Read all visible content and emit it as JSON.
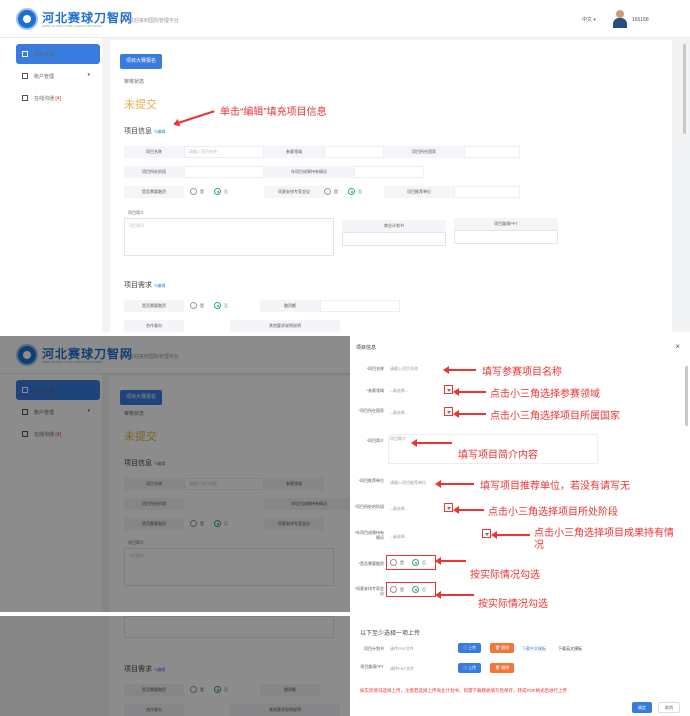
{
  "app": {
    "logo_text": "河北赛球刀智网",
    "logo_sub": "HEBEI GLOBAL INTELLIGENCE NETWORK",
    "welcome": "hi，欢迎来到国际管理平台",
    "language": "中文 ▾",
    "username": "165168"
  },
  "sidebar": {
    "items": [
      {
        "label": "项目大赛",
        "active": true
      },
      {
        "label": "账户管理",
        "chevron": "▾"
      },
      {
        "label": "在线沟通",
        "badge": "[4]"
      }
    ]
  },
  "main": {
    "tab": "项目大赛报名",
    "review_status_label": "审核状态",
    "status": "未提交",
    "project_info_title": "项目信息",
    "project_req_title": "项目需求",
    "edit": "✎编辑",
    "fields": {
      "name_label": "项目名称",
      "name_placeholder": "请输入项目名称",
      "field_label": "参赛领域",
      "country_label": "项目所在国家",
      "stage_label": "项目所处阶段",
      "result_label": "年项目成果持有情况",
      "invest_label": "是否需要融资",
      "yes": "是",
      "no": "否",
      "agree_label": "同意安排专家会议",
      "recommend_label": "项目推荐单位",
      "intro_label": "项目简介",
      "intro_placeholder": "项目简介",
      "bp_label": "商业计划书",
      "ppt_label": "项目路演PPT",
      "partner_label": "合作意向",
      "partner_desc_label": "其他要求说明说明",
      "finance_label": "是否需要融资",
      "amount_label": "融资额"
    }
  },
  "modal": {
    "title": "项目信息",
    "close": "×",
    "rows": [
      {
        "label": "项目名称",
        "value": "请输入项目名称"
      },
      {
        "label": "参赛领域",
        "value": "--请选择--"
      },
      {
        "label": "项目所在国家",
        "value": "--请选择--"
      },
      {
        "label": "项目简介",
        "value": "项目简介"
      },
      {
        "label": "项目推荐单位",
        "value": "请输入项目推荐单位"
      },
      {
        "label": "项目所处的阶段",
        "value": "--请选择--"
      },
      {
        "label": "年项目成果持有情况",
        "value": "--请选择--"
      },
      {
        "label": "是否需要融资"
      },
      {
        "label": "同意安排专家会议"
      }
    ],
    "upload_title": "以下至少选择一项上传",
    "bp_label": "项目计划书",
    "ppt_label": "项目路演PPT",
    "file_placeholder": "请传PDF文件",
    "upload_btn": "上传",
    "delete_btn": "删除",
    "download_cn": "下载中文模板",
    "download_en": "下载英文模板",
    "warning": "按实际情况选择上传，注意若选择上传商业计划书，则需下载模板填写后保存，转成PDF格式后进行上传",
    "ok": "确定",
    "cancel": "取消"
  },
  "annotations": {
    "top": "单击“编辑”填充项目信息",
    "name": "填写参赛项目名称",
    "field": "点击小三角选择参赛领域",
    "country": "点击小三角选择项目所属国家",
    "intro": "填写项目简介内容",
    "recommend": "填写项目推荐单位，若没有请写无",
    "stage": "点击小三角选择项目所处阶段",
    "result": "点击小三角选择项目成果持有情况",
    "finance": "按实际情况勾选",
    "agree": "按实际情况勾选"
  },
  "colors": {
    "primary": "#3a7be0",
    "annotation": "#e33333",
    "status": "#e2b04a",
    "radio_on": "#39a86b"
  }
}
